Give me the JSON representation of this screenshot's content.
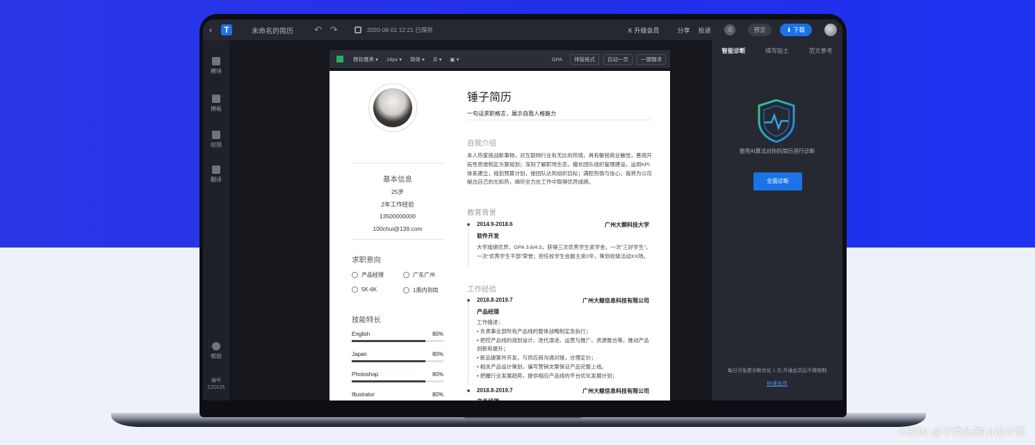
{
  "app": {
    "doc_name": "未命名的简历",
    "saved_status": "2020-08-01 12:21 已保存",
    "logo_letter": "T",
    "accent": "#1a73e8"
  },
  "topbar": {
    "upgrade": "升级会员",
    "share": "分享",
    "deliver": "投递",
    "preview": "预览",
    "download": "下载"
  },
  "sidebar": {
    "items": [
      {
        "label": "模块",
        "icon": "blocks-icon"
      },
      {
        "label": "模板",
        "icon": "layers-icon"
      },
      {
        "label": "权限",
        "icon": "shield-icon"
      },
      {
        "label": "翻译",
        "icon": "translate-icon"
      },
      {
        "label": "帮助",
        "icon": "help-icon"
      }
    ],
    "code_label": "编号",
    "code": "CZ0125"
  },
  "toolbar": {
    "font": "微软雅黑",
    "size": "14px",
    "lang": "简体",
    "gpa": "GPA",
    "format": "排版格式",
    "one_page": "自动一页",
    "translate": "一键翻译"
  },
  "resume": {
    "name": "锤子简历",
    "motto": "一句话求职格言，展示自我人格魅力",
    "basic_title": "基本信息",
    "age": "25岁",
    "experience": "2年工作经验",
    "phone": "13500000000",
    "email": "100chui@139.com",
    "intent_title": "求职意向",
    "intent": {
      "position": "产品经理",
      "city": "广东广州",
      "salary": "5K-6K",
      "arrival": "1周内到岗"
    },
    "skills_title": "技能特长",
    "skills": [
      {
        "name": "English",
        "level": "80%",
        "value": 0.8
      },
      {
        "name": "Japan",
        "level": "80%",
        "value": 0.8
      },
      {
        "name": "Photoshop",
        "level": "80%",
        "value": 0.8
      },
      {
        "name": "Illustrator",
        "level": "80%",
        "value": 0.8
      }
    ],
    "intro_title": "自我介绍",
    "intro": "本人热爱挑战新事物，对互联网行业有无比的热情，具有敏锐商业触觉，善用开拓性思维制定方案规划；深刻了解职场生态，擅长团队组织管理建设，运用KPI体系建立，规划预算计划，使团队达到组织目标；满腔热情与信心，我将为公司献出自己的光和热，竭尽全力在工作中取得优异成绩。",
    "edu_title": "教育背景",
    "edu": {
      "period": "2014.9-2018.6",
      "school": "广州大颗科技大学",
      "major": "软件开发",
      "desc": "大学成绩优异，GPA 3.8/4.0，获得三次优秀学生奖学金，一次“三好学生”，一次“优秀学生干部”荣誉；担任校学生会副主席2年，策划校级活动XX场。"
    },
    "work_title": "工作经验",
    "work": [
      {
        "period": "2018.8-2019.7",
        "company": "广州大鲸信息科技有限公司",
        "role": "产品经理",
        "desc_label": "工作描述：",
        "bullets": [
          "负责事业部所有产品线的整体战略制定及执行；",
          "把控产品线的规划设计、迭代演进、运营与推广、资源整合等，推动产品创新和提升；",
          "新品提案并开发，与供应商沟通对接，合理定价；",
          "相关产品设计策划，编写营销文案保证产品完整上线。",
          "把握行业发展趋势，提供相应产品线的平台优化发展计划；"
        ]
      },
      {
        "period": "2018.8-2019.7",
        "company": "广州大鲸信息科技有限公司",
        "role": "产品经理"
      }
    ]
  },
  "panel": {
    "tabs": [
      "智能诊断",
      "填写贴士",
      "范文参考"
    ],
    "desc": "使用AI算法对你的简历进行诊断",
    "button": "全面诊断",
    "foot_a": "每日可免费诊断优化",
    "foot_count": "1",
    "foot_b": "次,开通会员后不做限制",
    "link": "快速会员"
  },
  "watermark": "CSDN @不秃头的UI设计师"
}
